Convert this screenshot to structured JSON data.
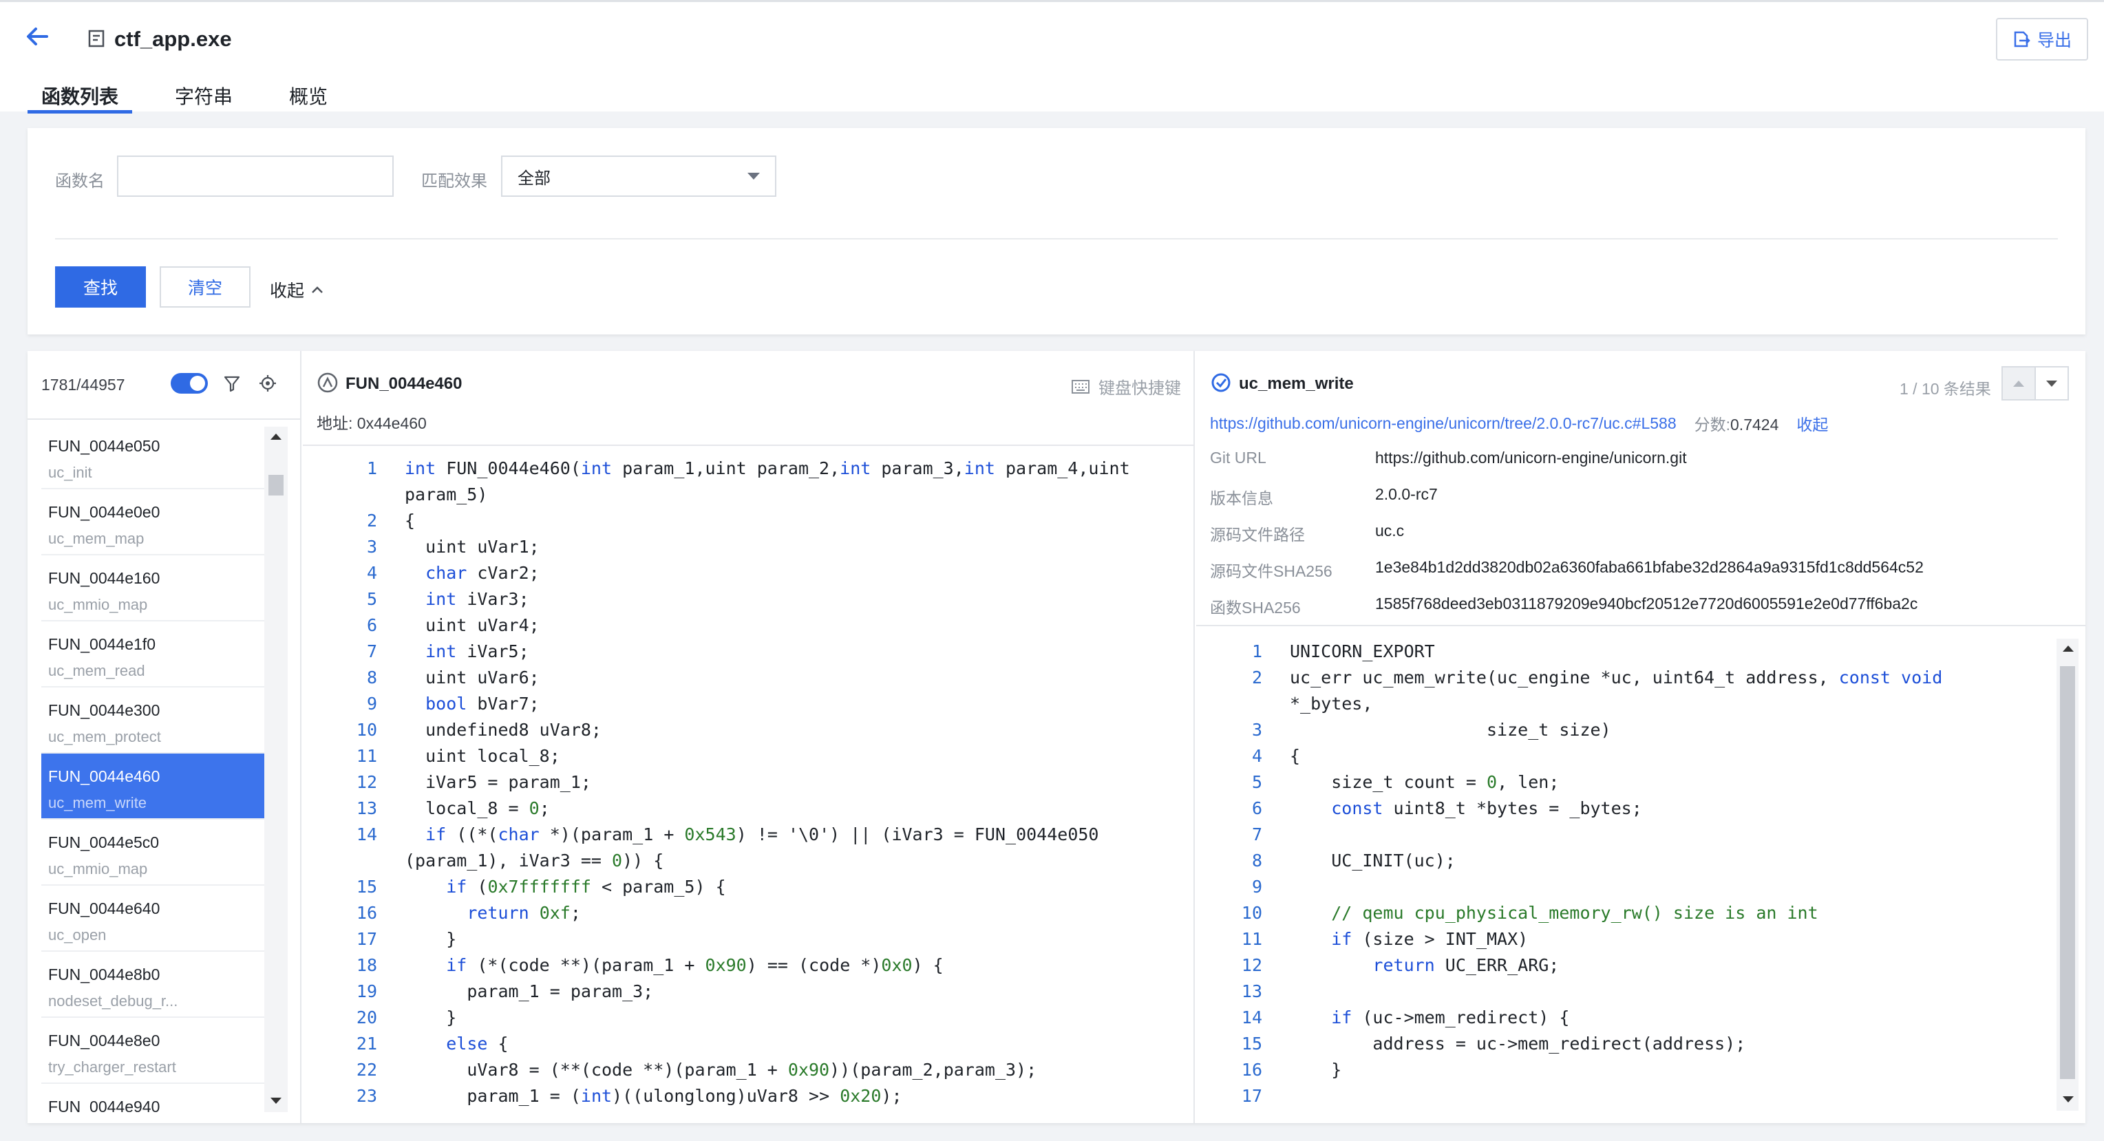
{
  "header": {
    "title": "ctf_app.exe",
    "export_label": "导出",
    "tabs": [
      {
        "label": "函数列表",
        "active": true
      },
      {
        "label": "字符串",
        "active": false
      },
      {
        "label": "概览",
        "active": false
      }
    ]
  },
  "filter": {
    "name_label": "函数名",
    "name_value": "",
    "match_label": "匹配效果",
    "match_value": "全部",
    "search_label": "查找",
    "clear_label": "清空",
    "collapse_label": "收起"
  },
  "list": {
    "count": "1781/44957",
    "items": [
      {
        "fn": "FUN_0044e050",
        "sub": "uc_init"
      },
      {
        "fn": "FUN_0044e0e0",
        "sub": "uc_mem_map"
      },
      {
        "fn": "FUN_0044e160",
        "sub": "uc_mmio_map"
      },
      {
        "fn": "FUN_0044e1f0",
        "sub": "uc_mem_read"
      },
      {
        "fn": "FUN_0044e300",
        "sub": "uc_mem_protect"
      },
      {
        "fn": "FUN_0044e460",
        "sub": "uc_mem_write"
      },
      {
        "fn": "FUN_0044e5c0",
        "sub": "uc_mmio_map"
      },
      {
        "fn": "FUN_0044e640",
        "sub": "uc_open"
      },
      {
        "fn": "FUN_0044e8b0",
        "sub": "nodeset_debug_r..."
      },
      {
        "fn": "FUN_0044e8e0",
        "sub": "try_charger_restart"
      },
      {
        "fn": "FUN_0044e940",
        "sub": ""
      }
    ],
    "selected_index": 5
  },
  "decompile": {
    "title": "FUN_0044e460",
    "address": "地址: 0x44e460",
    "shortcut_label": "键盘快捷键",
    "lines": [
      {
        "n": "1",
        "html": "<span class=\"kw\">int</span> FUN_0044e460(<span class=\"kw\">int</span> param_1,uint param_2,<span class=\"kw\">int</span> param_3,<span class=\"kw\">int</span> param_4,uint\nparam_5)"
      },
      {
        "n": "2",
        "html": "{"
      },
      {
        "n": "3",
        "html": "  uint uVar1;"
      },
      {
        "n": "4",
        "html": "  <span class=\"kw\">char</span> cVar2;"
      },
      {
        "n": "5",
        "html": "  <span class=\"kw\">int</span> iVar3;"
      },
      {
        "n": "6",
        "html": "  uint uVar4;"
      },
      {
        "n": "7",
        "html": "  <span class=\"kw\">int</span> iVar5;"
      },
      {
        "n": "8",
        "html": "  uint uVar6;"
      },
      {
        "n": "9",
        "html": "  <span class=\"kw\">bool</span> bVar7;"
      },
      {
        "n": "10",
        "html": "  undefined8 uVar8;"
      },
      {
        "n": "11",
        "html": "  uint local_8;"
      },
      {
        "n": "12",
        "html": "  iVar5 = param_1;"
      },
      {
        "n": "13",
        "html": "  local_8 = <span class=\"num\">0</span>;"
      },
      {
        "n": "14",
        "html": "  <span class=\"kw\">if</span> ((*(<span class=\"kw\">char</span> *)(param_1 + <span class=\"num\">0x543</span>) != '\\0') || (iVar3 = FUN_0044e050\n(param_1), iVar3 == <span class=\"num\">0</span>)) {"
      },
      {
        "n": "15",
        "html": "    <span class=\"kw\">if</span> (<span class=\"num\">0x7fffffff</span> &lt; param_5) {"
      },
      {
        "n": "16",
        "html": "      <span class=\"kw\">return</span> <span class=\"num\">0xf</span>;"
      },
      {
        "n": "17",
        "html": "    }"
      },
      {
        "n": "18",
        "html": "    <span class=\"kw\">if</span> (*(code **)(param_1 + <span class=\"num\">0x90</span>) == (code *)<span class=\"num\">0x0</span>) {"
      },
      {
        "n": "19",
        "html": "      param_1 = param_3;"
      },
      {
        "n": "20",
        "html": "    }"
      },
      {
        "n": "21",
        "html": "    <span class=\"kw\">else</span> {"
      },
      {
        "n": "22",
        "html": "      uVar8 = (**(code **)(param_1 + <span class=\"num\">0x90</span>))(param_2,param_3);"
      },
      {
        "n": "23",
        "html": "      param_1 = (<span class=\"kw\">int</span>)((ulonglong)uVar8 &gt;&gt; <span class=\"num\">0x20</span>);"
      }
    ]
  },
  "match": {
    "title": "uc_mem_write",
    "results": "1 / 10 条结果",
    "source_link": "https://github.com/unicorn-engine/unicorn/tree/2.0.0-rc7/uc.c#L588",
    "score_label": "分数:",
    "score_value": "0.7424",
    "collapse_label": "收起",
    "meta": [
      {
        "k": "Git URL",
        "v": "https://github.com/unicorn-engine/unicorn.git",
        "link": true
      },
      {
        "k": "版本信息",
        "v": "2.0.0-rc7",
        "link": false
      },
      {
        "k": "源码文件路径",
        "v": "uc.c",
        "link": false
      },
      {
        "k": "源码文件SHA256",
        "v": "1e3e84b1d2dd3820db02a6360faba661bfabe32d2864a9a9315fd1c8dd564c52",
        "link": false
      },
      {
        "k": "函数SHA256",
        "v": "1585f768deed3eb0311879209e940bcf20512e7720d6005591e2e0d77ff6ba2c",
        "link": false
      }
    ],
    "lines": [
      {
        "n": "1",
        "html": "UNICORN_EXPORT"
      },
      {
        "n": "2",
        "html": "uc_err uc_mem_write(uc_engine *uc, uint64_t address, <span class=\"kw\">const</span> <span class=\"kw\">void</span>\n*_bytes,"
      },
      {
        "n": "3",
        "html": "                   size_t size)"
      },
      {
        "n": "4",
        "html": "{"
      },
      {
        "n": "5",
        "html": "    size_t count = <span class=\"num\">0</span>, len;"
      },
      {
        "n": "6",
        "html": "    <span class=\"kw\">const</span> uint8_t *bytes = _bytes;"
      },
      {
        "n": "7",
        "html": ""
      },
      {
        "n": "8",
        "html": "    UC_INIT(uc);"
      },
      {
        "n": "9",
        "html": ""
      },
      {
        "n": "10",
        "html": "    <span class=\"cm\">// qemu cpu_physical_memory_rw() size is an int</span>"
      },
      {
        "n": "11",
        "html": "    <span class=\"kw\">if</span> (size &gt; INT_MAX)"
      },
      {
        "n": "12",
        "html": "        <span class=\"kw\">return</span> UC_ERR_ARG;"
      },
      {
        "n": "13",
        "html": ""
      },
      {
        "n": "14",
        "html": "    <span class=\"kw\">if</span> (uc-&gt;mem_redirect) {"
      },
      {
        "n": "15",
        "html": "        address = uc-&gt;mem_redirect(address);"
      },
      {
        "n": "16",
        "html": "    }"
      },
      {
        "n": "17",
        "html": ""
      }
    ]
  }
}
